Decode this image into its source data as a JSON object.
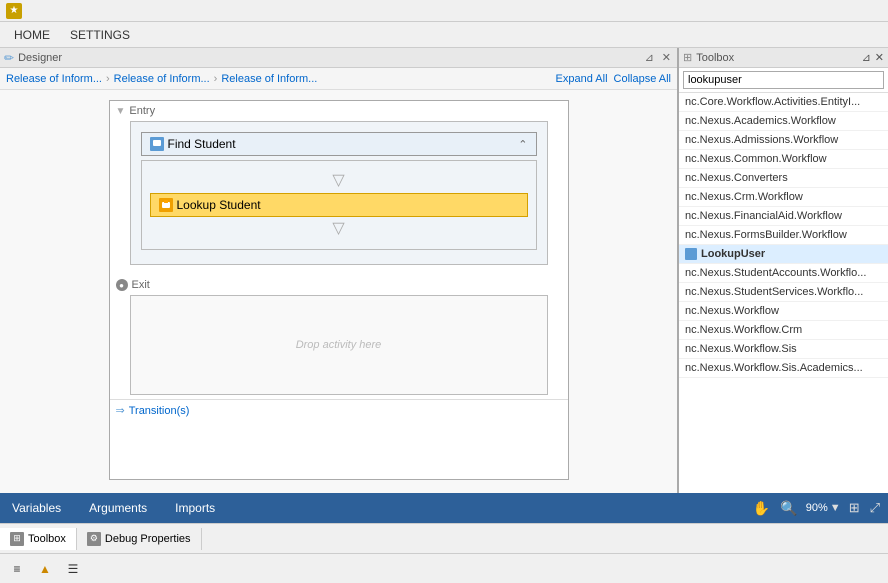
{
  "titlebar": {
    "icon": "★",
    "pin_icon": "📌",
    "close_icon": "✕"
  },
  "menubar": {
    "items": [
      "HOME",
      "SETTINGS"
    ]
  },
  "designer": {
    "header_label": "Designer",
    "pin_label": "⊿",
    "close_label": "✕"
  },
  "breadcrumb": {
    "items": [
      "Release of Inform...",
      "Release of Inform...",
      "Release of Inform..."
    ],
    "expand_label": "Expand All",
    "collapse_label": "Collapse All"
  },
  "workflow": {
    "entry_label": "Entry",
    "find_student_label": "Find Student",
    "lookup_student_label": "Lookup Student",
    "exit_label": "Exit",
    "drop_label": "Drop activity here",
    "transitions_label": "Transition(s)"
  },
  "toolbox": {
    "header_label": "Toolbox",
    "search_placeholder": "lookupuser",
    "pin_label": "⊿",
    "close_label": "✕",
    "items": [
      {
        "text": "nc.Core.Workflow.Activities.EntityI...",
        "highlighted": false
      },
      {
        "text": "nc.Nexus.Academics.Workflow",
        "highlighted": false
      },
      {
        "text": "nc.Nexus.Admissions.Workflow",
        "highlighted": false
      },
      {
        "text": "nc.Nexus.Common.Workflow",
        "highlighted": false
      },
      {
        "text": "nc.Nexus.Converters",
        "highlighted": false
      },
      {
        "text": "nc.Nexus.Crm.Workflow",
        "highlighted": false
      },
      {
        "text": "nc.Nexus.FinancialAid.Workflow",
        "highlighted": false
      },
      {
        "text": "nc.Nexus.FormsBuilder.Workflow",
        "highlighted": false
      },
      {
        "text": "LookupUser",
        "highlighted": true,
        "has_icon": true
      },
      {
        "text": "nc.Nexus.StudentAccounts.Workflo...",
        "highlighted": false
      },
      {
        "text": "nc.Nexus.StudentServices.Workflo...",
        "highlighted": false
      },
      {
        "text": "nc.Nexus.Workflow",
        "highlighted": false
      },
      {
        "text": "nc.Nexus.Workflow.Crm",
        "highlighted": false
      },
      {
        "text": "nc.Nexus.Workflow.Sis",
        "highlighted": false
      },
      {
        "text": "nc.Nexus.Workflow.Sis.Academics...",
        "highlighted": false
      }
    ]
  },
  "bottom_tabs": {
    "variables_label": "Variables",
    "arguments_label": "Arguments",
    "imports_label": "Imports",
    "zoom_value": "90%",
    "hand_icon": "✋",
    "search_icon": "🔍"
  },
  "bottom_panel": {
    "toolbox_label": "Toolbox",
    "debug_label": "Debug Properties"
  },
  "bottom_icons": [
    {
      "name": "menu-icon",
      "symbol": "≡"
    },
    {
      "name": "warning-icon",
      "symbol": "▲"
    },
    {
      "name": "list-icon",
      "symbol": "☰"
    }
  ]
}
